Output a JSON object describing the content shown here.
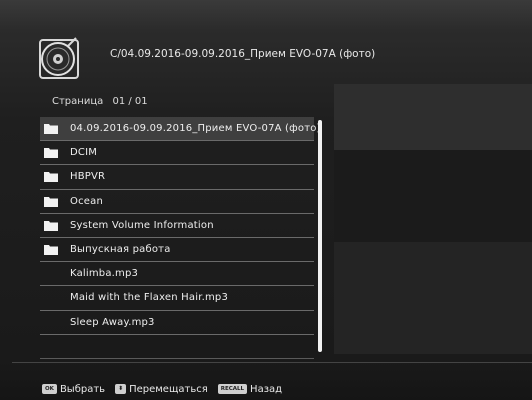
{
  "header": {
    "path": "C/04.09.2016-09.09.2016_Прием EVO-07A (фото)"
  },
  "pager": {
    "label": "Страница",
    "value": "01 / 01"
  },
  "files": [
    {
      "name": "04.09.2016-09.09.2016_Прием EVO-07A (фото)",
      "type": "folder"
    },
    {
      "name": "DCIM",
      "type": "folder"
    },
    {
      "name": "HBPVR",
      "type": "folder"
    },
    {
      "name": "Ocean",
      "type": "folder"
    },
    {
      "name": "System Volume Information",
      "type": "folder"
    },
    {
      "name": "Выпускная работа",
      "type": "folder"
    },
    {
      "name": "Kalimba.mp3",
      "type": "file"
    },
    {
      "name": "Maid with the Flaxen Hair.mp3",
      "type": "file"
    },
    {
      "name": "Sleep Away.mp3",
      "type": "file"
    }
  ],
  "footer": {
    "ok_key": "OK",
    "ok_label": "Выбрать",
    "move_key": "⬍",
    "move_label": "Перемещаться",
    "recall_key": "RECALL",
    "recall_label": "Назад"
  },
  "colors": {
    "background": "#1c1c1c",
    "text": "#efefef",
    "row_divider": "#6a6a6a",
    "selected_row": "#3f3f3f",
    "scrollbar": "#f2f2f2"
  }
}
